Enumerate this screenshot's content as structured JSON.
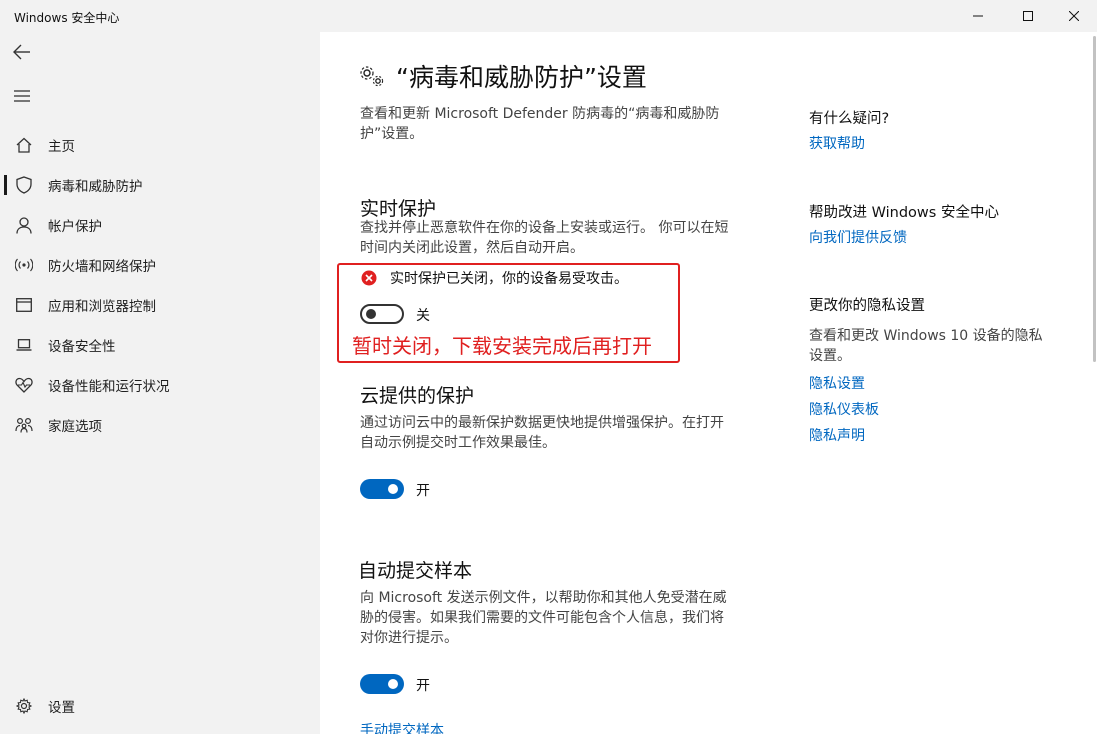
{
  "window": {
    "title": "Windows 安全中心"
  },
  "sidebar": {
    "items": [
      {
        "label": "主页",
        "icon": "home-icon"
      },
      {
        "label": "病毒和威胁防护",
        "icon": "shield-icon"
      },
      {
        "label": "帐户保护",
        "icon": "person-icon"
      },
      {
        "label": "防火墙和网络保护",
        "icon": "wifi-broadcast-icon"
      },
      {
        "label": "应用和浏览器控制",
        "icon": "browser-window-icon"
      },
      {
        "label": "设备安全性",
        "icon": "laptop-icon"
      },
      {
        "label": "设备性能和运行状况",
        "icon": "heart-pulse-icon"
      },
      {
        "label": "家庭选项",
        "icon": "family-icon"
      }
    ],
    "selected_index": 1,
    "settings_label": "设置"
  },
  "main": {
    "title": "“病毒和威胁防护”设置",
    "description_lines": [
      "查看和更新 Microsoft Defender 防病毒的“病毒和威胁防",
      "护”设置。"
    ],
    "realtime": {
      "title": "实时保护",
      "description_lines": [
        "查找并停止恶意软件在你的设备上安装或运行。 你可以在短",
        "时间内关闭此设置，然后自动开启。"
      ],
      "alert": "实时保护已关闭，你的设备易受攻击。",
      "toggle_state": "off",
      "toggle_label": "关",
      "annotation": "暂时关闭，下载安装完成后再打开"
    },
    "cloud": {
      "title": "云提供的保护",
      "description_lines": [
        "通过访问云中的最新保护数据更快地提供增强保护。在打开",
        "自动示例提交时工作效果最佳。"
      ],
      "toggle_state": "on",
      "toggle_label": "开"
    },
    "sample": {
      "title": "自动提交样本",
      "description_lines": [
        "向 Microsoft 发送示例文件，以帮助你和其他人免受潜在威",
        "胁的侵害。如果我们需要的文件可能包含个人信息，我们将",
        "对你进行提示。"
      ],
      "toggle_state": "on",
      "toggle_label": "开",
      "link": "手动提交样本"
    }
  },
  "aside": {
    "help": {
      "title": "有什么疑问?",
      "link": "获取帮助"
    },
    "improve": {
      "title": "帮助改进 Windows 安全中心",
      "link": "向我们提供反馈"
    },
    "privacy": {
      "title": "更改你的隐私设置",
      "description_lines": [
        "查看和更改 Windows 10 设备的隐私",
        "设置。"
      ],
      "links": [
        "隐私设置",
        "隐私仪表板",
        "隐私声明"
      ]
    }
  },
  "colors": {
    "accent": "#0067c0",
    "alert_red": "#e02020",
    "sidebar_bg": "#f2f2f2"
  }
}
